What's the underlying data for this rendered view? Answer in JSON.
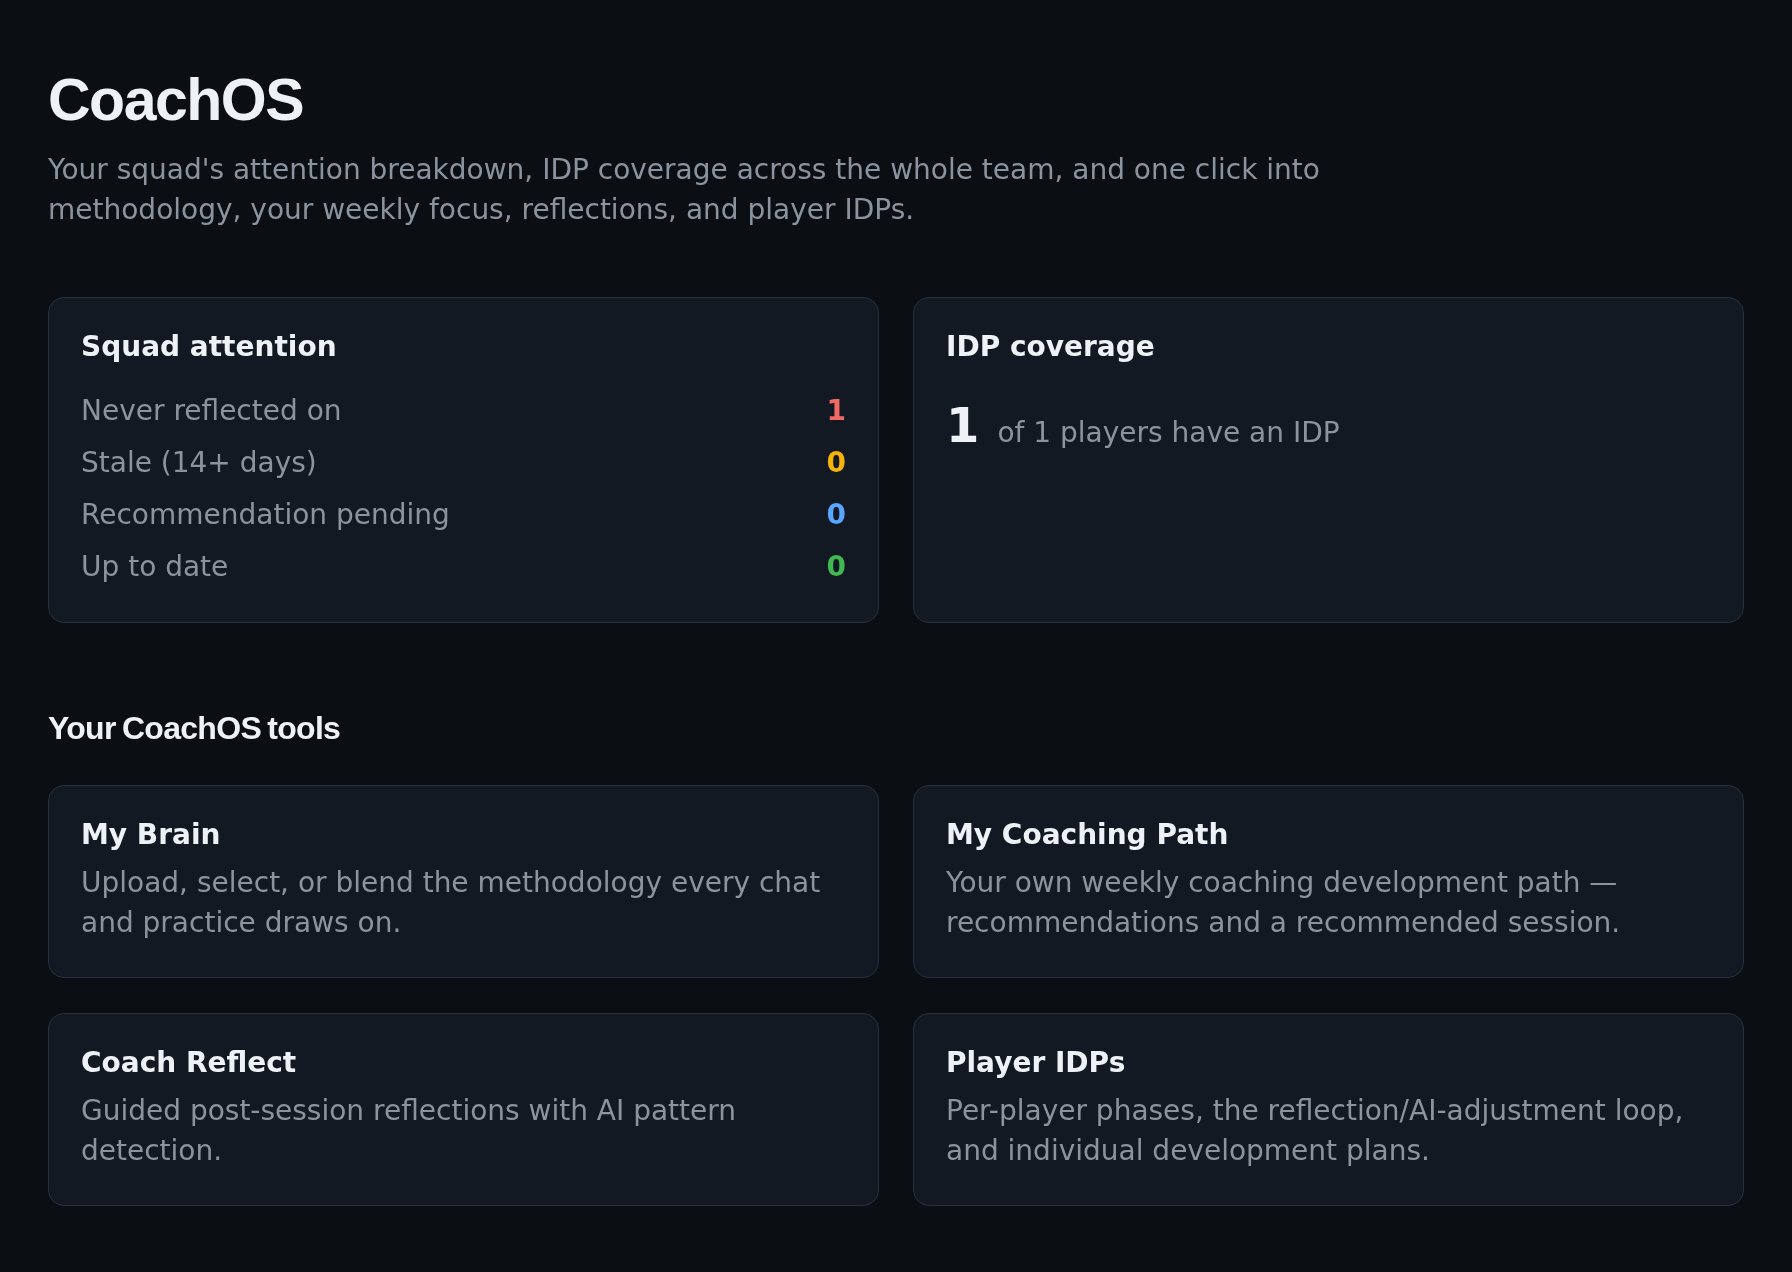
{
  "header": {
    "title": "CoachOS",
    "subtitle": "Your squad's attention breakdown, IDP coverage across the whole team, and one click into methodology, your weekly focus, reflections, and player IDPs."
  },
  "squad_attention": {
    "title": "Squad attention",
    "rows": [
      {
        "label": "Never reflected on",
        "count": "1",
        "color": "#f06a63"
      },
      {
        "label": "Stale (14+ days)",
        "count": "0",
        "color": "#f5b30a"
      },
      {
        "label": "Recommendation pending",
        "count": "0",
        "color": "#58a6ff"
      },
      {
        "label": "Up to date",
        "count": "0",
        "color": "#3fb950"
      }
    ]
  },
  "idp_coverage": {
    "title": "IDP coverage",
    "count": "1",
    "caption": "of 1 players have an IDP"
  },
  "tools": {
    "heading": "Your CoachOS tools",
    "items": [
      {
        "title": "My Brain",
        "description": "Upload, select, or blend the methodology every chat and practice draws on."
      },
      {
        "title": "My Coaching Path",
        "description": "Your own weekly coaching development path — recommendations and a recommended session."
      },
      {
        "title": "Coach Reflect",
        "description": "Guided post-session reflections with AI pattern detection."
      },
      {
        "title": "Player IDPs",
        "description": "Per-player phases, the reflection/AI-adjustment loop, and individual development plans."
      }
    ]
  }
}
